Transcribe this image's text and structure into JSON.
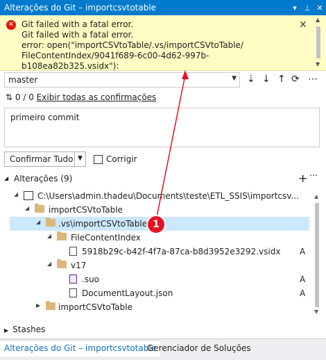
{
  "window": {
    "title": "Alterações do Git – importcsvtotable"
  },
  "error": {
    "text": "Git failed with a fatal error.\nGit failed with a fatal error.\nerror: open(\"importCSVtoTable/.vs/importCSVtoTable/\nFileContentIndex/9041f689-6c00-4d62-997b-b108ea82b325.vsidx\"):\nPermission denied"
  },
  "branch": {
    "name": "master"
  },
  "commits": {
    "count": "0 / 0",
    "link": "Exibir todas as confirmações"
  },
  "message": {
    "value": "primeiro commit"
  },
  "actions": {
    "commit_all": "Confirmar Tudo",
    "amend": "Corrigir"
  },
  "changes": {
    "header": "Alterações (9)",
    "tree": [
      {
        "name": "C:\\Users\\admin.thadeu\\Documents\\teste\\ETL_SSIS\\importcsv...",
        "status": ""
      },
      {
        "name": "importCSVtoTable",
        "status": ""
      },
      {
        "name": ".vs\\importCSVtoTable",
        "status": ""
      },
      {
        "name": "FileContentIndex",
        "status": ""
      },
      {
        "name": "5918b29c-b42f-4f7a-87ca-b8d3952e3292.vsidx",
        "status": "A"
      },
      {
        "name": "v17",
        "status": ""
      },
      {
        "name": ".suo",
        "status": "A"
      },
      {
        "name": "DocumentLayout.json",
        "status": "A"
      },
      {
        "name": "importCSVtoTable",
        "status": ""
      }
    ]
  },
  "stashes": {
    "label": "Stashes"
  },
  "tabs": [
    {
      "label": "Alterações do Git – importcsvtotable"
    },
    {
      "label": "Gerenciador de Soluções"
    }
  ],
  "annotation": {
    "badge": "1",
    "color": "#e81123"
  }
}
